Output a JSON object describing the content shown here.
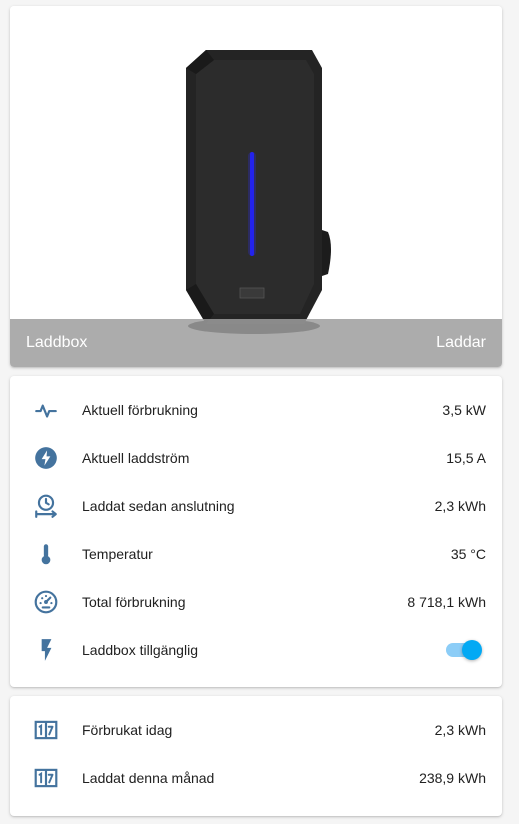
{
  "picture_card": {
    "name": "Laddbox",
    "state": "Laddar"
  },
  "entities": [
    {
      "icon": "pulse-icon",
      "label": "Aktuell förbrukning",
      "value": "3,5 kW"
    },
    {
      "icon": "lightning-circle-icon",
      "label": "Aktuell laddström",
      "value": "15,5 A"
    },
    {
      "icon": "clock-arrow-icon",
      "label": "Laddat sedan anslutning",
      "value": "2,3 kWh"
    },
    {
      "icon": "thermometer-icon",
      "label": "Temperatur",
      "value": "35 °C"
    },
    {
      "icon": "gauge-icon",
      "label": "Total förbrukning",
      "value": "8 718,1 kWh"
    },
    {
      "icon": "flash-icon",
      "label": "Laddbox tillgänglig",
      "toggle_on": true
    }
  ],
  "statistics": [
    {
      "icon": "counter-icon",
      "label": "Förbrukat idag",
      "value": "2,3 kWh"
    },
    {
      "icon": "counter-icon",
      "label": "Laddat denna månad",
      "value": "238,9 kWh"
    }
  ],
  "colors": {
    "icon": "#44739e",
    "toggle_active": "#03a9f4",
    "footer_overlay": "#9e9e9e"
  }
}
